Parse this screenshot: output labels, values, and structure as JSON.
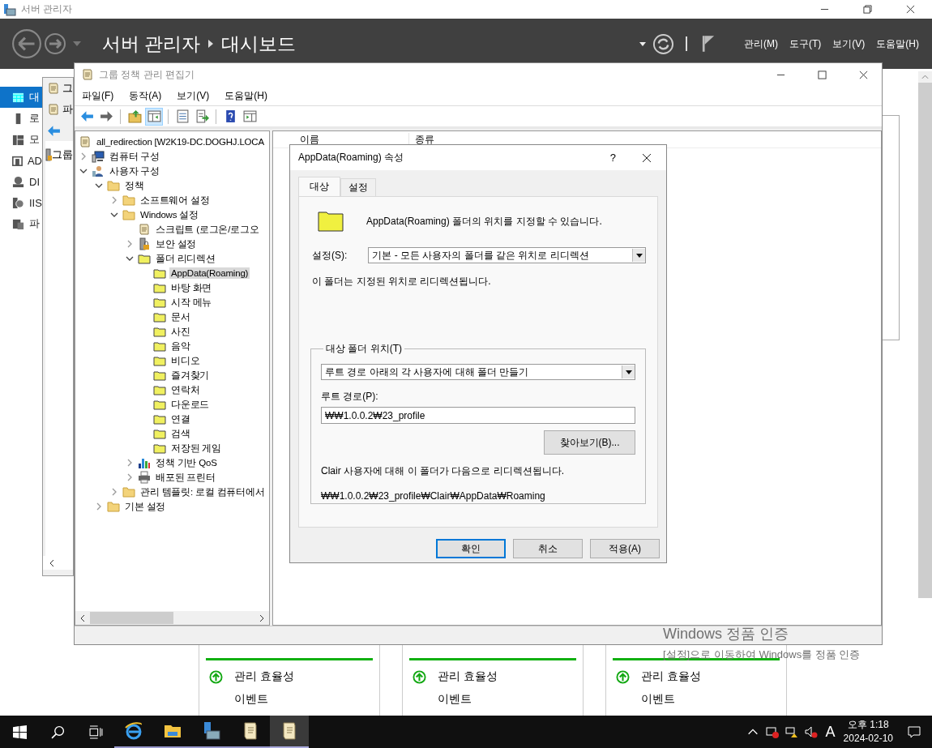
{
  "server_manager": {
    "title": "서버 관리자",
    "breadcrumb": [
      "서버 관리자",
      "대시보드"
    ],
    "menu": [
      "관리(M)",
      "도구(T)",
      "보기(V)",
      "도움말(H)"
    ],
    "nav": [
      {
        "label": "대",
        "kind": "dashboard",
        "selected": true
      },
      {
        "label": "로",
        "kind": "local",
        "selected": false
      },
      {
        "label": "모",
        "kind": "all",
        "selected": false
      },
      {
        "label": "AD",
        "kind": "ad",
        "selected": false
      },
      {
        "label": "DI",
        "kind": "dns",
        "selected": false
      },
      {
        "label": "IIS",
        "kind": "iis",
        "selected": false
      },
      {
        "label": "파",
        "kind": "files",
        "selected": false
      }
    ],
    "tiles": [
      {
        "rows": [
          "관리 효율성",
          "이벤트"
        ]
      },
      {
        "rows": [
          "관리 효율성",
          "이벤트"
        ]
      },
      {
        "rows": [
          "관리 효율성",
          "이벤트"
        ]
      }
    ]
  },
  "back_window": {
    "title": "그",
    "menu": "파",
    "tree_item": "그룹"
  },
  "editor": {
    "title": "그룹 정책 관리 편집기",
    "menu": [
      "파일(F)",
      "동작(A)",
      "보기(V)",
      "도움말(H)"
    ],
    "toolbar": [
      {
        "kind": "back",
        "pressed": false
      },
      {
        "kind": "forward",
        "pressed": false
      },
      {
        "kind": "separator"
      },
      {
        "kind": "up",
        "pressed": false
      },
      {
        "kind": "tree",
        "pressed": true
      },
      {
        "kind": "separator"
      },
      {
        "kind": "properties",
        "pressed": false
      },
      {
        "kind": "export",
        "pressed": false
      },
      {
        "kind": "separator"
      },
      {
        "kind": "help",
        "pressed": false
      },
      {
        "kind": "view",
        "pressed": false
      }
    ],
    "tree": [
      {
        "label": "all_redirection [W2K19-DC.DOGHJ.LOCA",
        "kind": "gpo",
        "selected": false,
        "children": [
          {
            "label": "컴퓨터 구성",
            "kind": "computer",
            "expanded": false,
            "selected": false
          },
          {
            "label": "사용자 구성",
            "kind": "user",
            "expanded": true,
            "selected": false,
            "children": [
              {
                "label": "정책",
                "kind": "folder",
                "expanded": true,
                "selected": false,
                "children": [
                  {
                    "label": "소프트웨어 설정",
                    "kind": "folder",
                    "expanded": false,
                    "selected": false
                  },
                  {
                    "label": "Windows 설정",
                    "kind": "folder",
                    "expanded": true,
                    "selected": false,
                    "children": [
                      {
                        "label": "스크립트 (로그온/로그오",
                        "kind": "script",
                        "selected": false
                      },
                      {
                        "label": "보안 설정",
                        "kind": "security",
                        "expanded": false,
                        "selected": false
                      },
                      {
                        "label": "폴더 리디렉션",
                        "kind": "redirect",
                        "expanded": true,
                        "selected": false,
                        "children": [
                          {
                            "label": "AppData(Roaming)",
                            "kind": "redirect",
                            "selected": true
                          },
                          {
                            "label": "바탕 화면",
                            "kind": "redirect",
                            "selected": false
                          },
                          {
                            "label": "시작 메뉴",
                            "kind": "redirect",
                            "selected": false
                          },
                          {
                            "label": "문서",
                            "kind": "redirect",
                            "selected": false
                          },
                          {
                            "label": "사진",
                            "kind": "redirect",
                            "selected": false
                          },
                          {
                            "label": "음악",
                            "kind": "redirect",
                            "selected": false
                          },
                          {
                            "label": "비디오",
                            "kind": "redirect",
                            "selected": false
                          },
                          {
                            "label": "즐겨찾기",
                            "kind": "redirect",
                            "selected": false
                          },
                          {
                            "label": "연락처",
                            "kind": "redirect",
                            "selected": false
                          },
                          {
                            "label": "다운로드",
                            "kind": "redirect",
                            "selected": false
                          },
                          {
                            "label": "연결",
                            "kind": "redirect",
                            "selected": false
                          },
                          {
                            "label": "검색",
                            "kind": "redirect",
                            "selected": false
                          },
                          {
                            "label": "저장된 게임",
                            "kind": "redirect",
                            "selected": false
                          }
                        ]
                      },
                      {
                        "label": "정책 기반 QoS",
                        "kind": "qos",
                        "expanded": false,
                        "selected": false
                      },
                      {
                        "label": "배포된 프린터",
                        "kind": "printer",
                        "expanded": false,
                        "selected": false
                      }
                    ]
                  },
                  {
                    "label": "관리 템플릿: 로컬 컴퓨터에서",
                    "kind": "folder",
                    "expanded": false,
                    "selected": false
                  }
                ]
              },
              {
                "label": "기본 설정",
                "kind": "folder",
                "expanded": false,
                "selected": false
              }
            ]
          }
        ]
      }
    ],
    "columns": [
      "이름",
      "종류"
    ]
  },
  "dialog": {
    "title": "AppData(Roaming) 속성",
    "help": "?",
    "tabs": [
      {
        "label": "대상",
        "selected": true
      },
      {
        "label": "설정",
        "selected": false
      }
    ],
    "intro": "AppData(Roaming) 폴더의 위치를 지정할 수 있습니다.",
    "setting_label": "설정(S):",
    "setting_value": "기본 - 모든 사용자의 폴더를 같은 위치로 리디렉션",
    "setting_note": "이 폴더는 지정된 위치로 리디렉션됩니다.",
    "group_title": "대상 폴더 위치(T)",
    "location_value": "루트 경로 아래의 각 사용자에 대해 폴더 만들기",
    "root_label": "루트 경로(P):",
    "root_value": "₩₩1.0.0.2₩23_profile",
    "browse": "찾아보기(B)...",
    "result_note": "Clair 사용자에 대해 이 폴더가 다음으로 리디렉션됩니다.",
    "result_path": "₩₩1.0.0.2₩23_profile₩Clair₩AppData₩Roaming",
    "buttons": [
      {
        "label": "확인",
        "default": true
      },
      {
        "label": "취소",
        "default": false
      },
      {
        "label": "적용(A)",
        "default": false
      }
    ]
  },
  "activation": [
    "Windows 정품 인증",
    "[설정]으로 이동하여 Windows를 정품 인증"
  ],
  "taskbar": {
    "apps": [
      {
        "kind": "browser",
        "selected": false
      },
      {
        "kind": "explorer",
        "selected": false
      },
      {
        "kind": "server",
        "selected": false
      },
      {
        "kind": "scroll",
        "selected": false
      },
      {
        "kind": "scroll",
        "selected": true
      }
    ],
    "ime": "A",
    "time": "오후 1:18",
    "date": "2024-02-10"
  }
}
